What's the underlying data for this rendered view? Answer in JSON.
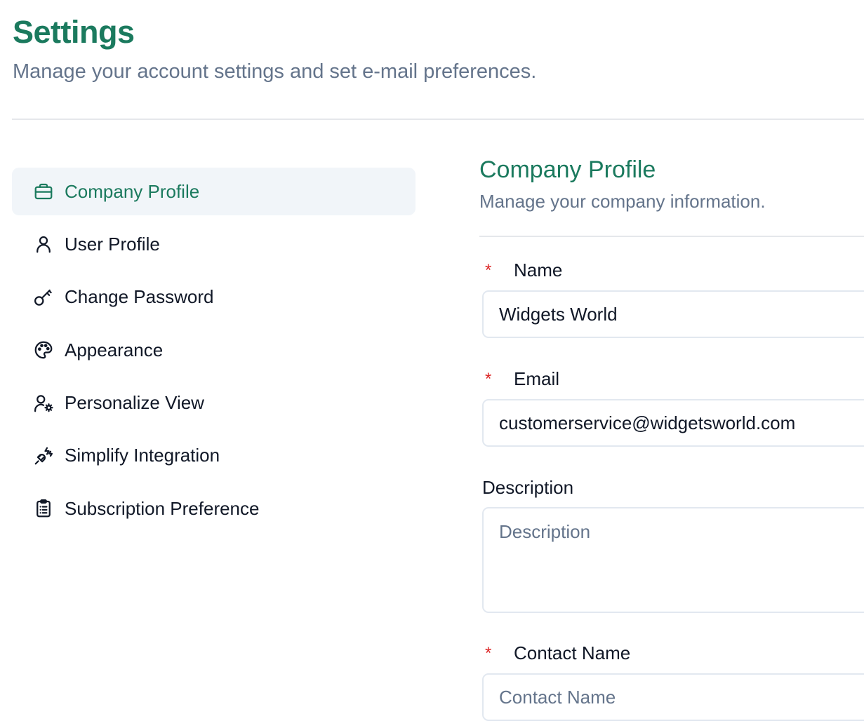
{
  "header": {
    "title": "Settings",
    "subtitle": "Manage your account settings and set e-mail preferences."
  },
  "sidebar": {
    "items": [
      {
        "label": "Company Profile",
        "icon": "briefcase-icon",
        "active": true
      },
      {
        "label": "User Profile",
        "icon": "user-icon",
        "active": false
      },
      {
        "label": "Change Password",
        "icon": "key-icon",
        "active": false
      },
      {
        "label": "Appearance",
        "icon": "palette-icon",
        "active": false
      },
      {
        "label": "Personalize View",
        "icon": "user-cog-icon",
        "active": false
      },
      {
        "label": "Simplify Integration",
        "icon": "plug-icon",
        "active": false
      },
      {
        "label": "Subscription Preference",
        "icon": "clipboard-list-icon",
        "active": false
      }
    ]
  },
  "main": {
    "title": "Company Profile",
    "subtitle": "Manage your company information.",
    "fields": {
      "name": {
        "label": "Name",
        "required": true,
        "value": "Widgets World",
        "placeholder": ""
      },
      "email": {
        "label": "Email",
        "required": true,
        "value": "customerservice@widgetsworld.com",
        "placeholder": ""
      },
      "description": {
        "label": "Description",
        "required": false,
        "value": "",
        "placeholder": "Description"
      },
      "contact_name": {
        "label": "Contact Name",
        "required": true,
        "value": "",
        "placeholder": "Contact Name"
      }
    },
    "required_marker": "*"
  },
  "colors": {
    "accent": "#1b7a5e",
    "muted_text": "#64748b",
    "active_bg": "#f1f5f9",
    "required": "#dc2626",
    "border": "#e2e8f0"
  }
}
